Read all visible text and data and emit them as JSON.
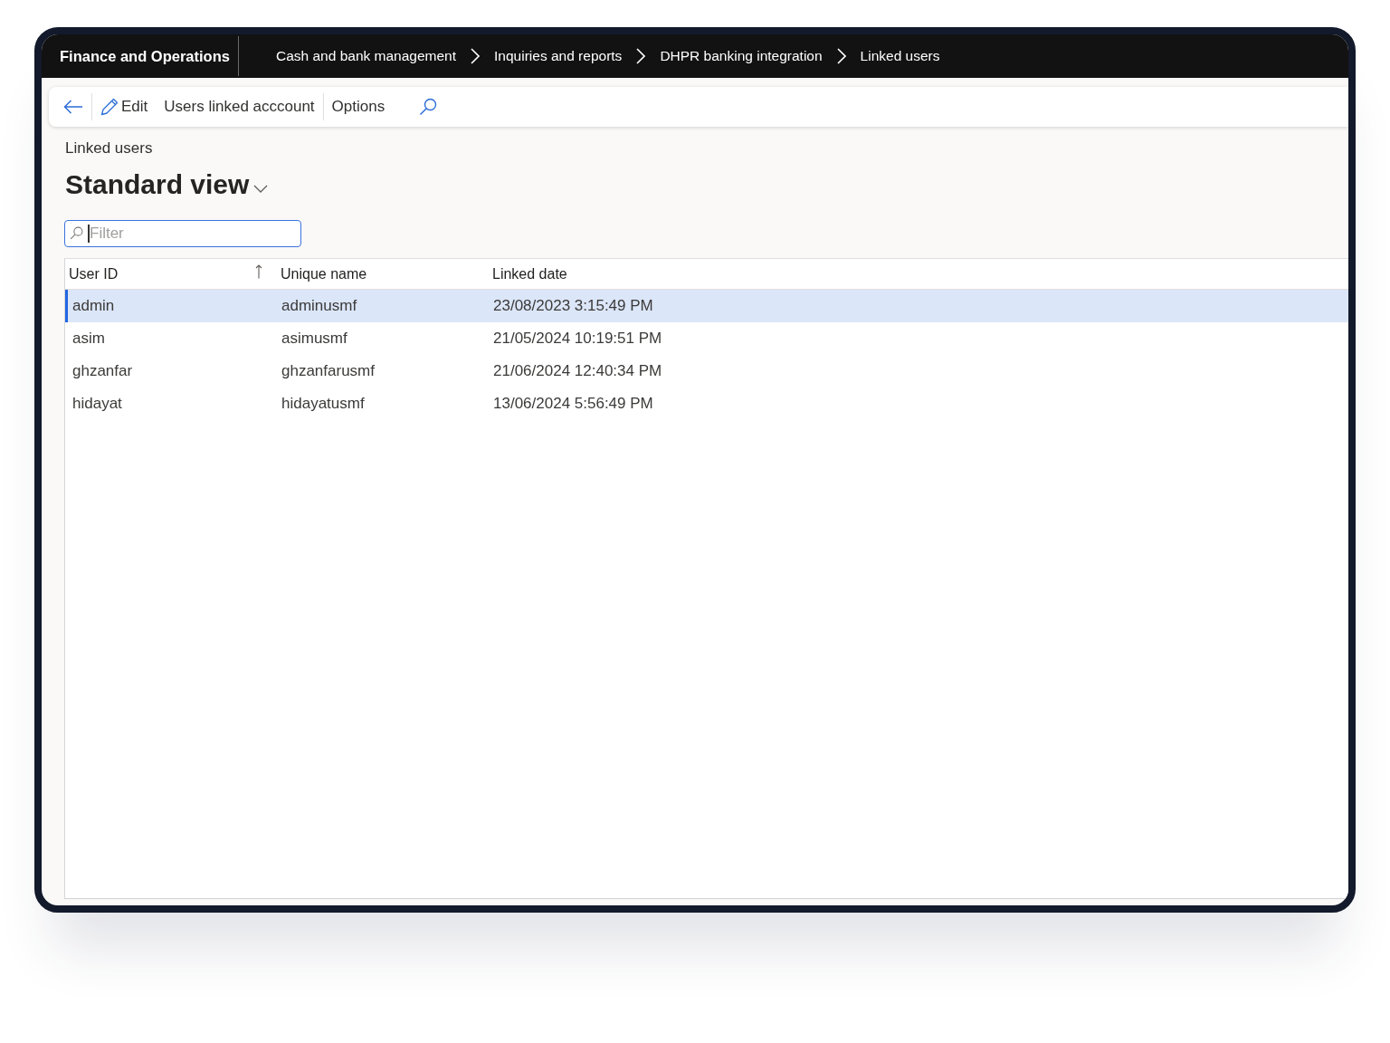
{
  "app": {
    "title": "Finance and Operations"
  },
  "breadcrumbs": [
    "Cash and bank management",
    "Inquiries and reports",
    "DHPR banking integration",
    "Linked users"
  ],
  "action_bar": {
    "groups": [
      [
        {
          "kind": "back"
        }
      ],
      [
        {
          "kind": "edit",
          "label": "Edit"
        },
        {
          "kind": "button",
          "label": "Users linked acccount"
        }
      ],
      [
        {
          "kind": "button",
          "label": "Options"
        },
        {
          "kind": "search"
        }
      ]
    ]
  },
  "page": {
    "caption": "Linked users",
    "view_title": "Standard view"
  },
  "filter": {
    "placeholder": "Filter",
    "focused": true
  },
  "grid": {
    "columns": [
      {
        "label": "User ID",
        "sorted": true
      },
      {
        "label": "Unique name",
        "sorted": false
      },
      {
        "label": "Linked date",
        "sorted": false
      }
    ],
    "rows": [
      {
        "cells": [
          "admin",
          "adminusmf",
          "23/08/2023 3:15:49 PM"
        ],
        "selected": true
      },
      {
        "cells": [
          "asim",
          "asimusmf",
          "21/05/2024 10:19:51 PM"
        ],
        "selected": false
      },
      {
        "cells": [
          "ghzanfar",
          "ghzanfarusmf",
          "21/06/2024 12:40:34 PM"
        ],
        "selected": false
      },
      {
        "cells": [
          "hidayat",
          "hidayatusmf",
          "13/06/2024 5:56:49 PM"
        ],
        "selected": false
      }
    ]
  }
}
